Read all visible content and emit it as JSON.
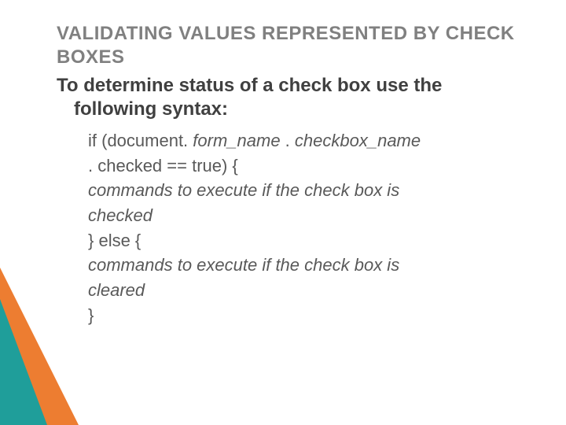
{
  "slide": {
    "title": "VALIDATING VALUES REPRESENTED BY CHECK BOXES",
    "subtitle_line1": "To determine status of a check box use the",
    "subtitle_line2": "following syntax:",
    "code": {
      "l1a": "if (document. ",
      "l1b": "form_name",
      "l1c": " . ",
      "l1d": "checkbox_name",
      "l2": ". checked  == true) {",
      "l3a": "commands to execute if the check box is",
      "l3b": "checked",
      "l4": "} else {",
      "l5a": "commands to execute if the check box is",
      "l5b": "cleared",
      "l6": "}"
    }
  },
  "colors": {
    "orange": "#ED7D31",
    "teal": "#1F9E9A"
  }
}
